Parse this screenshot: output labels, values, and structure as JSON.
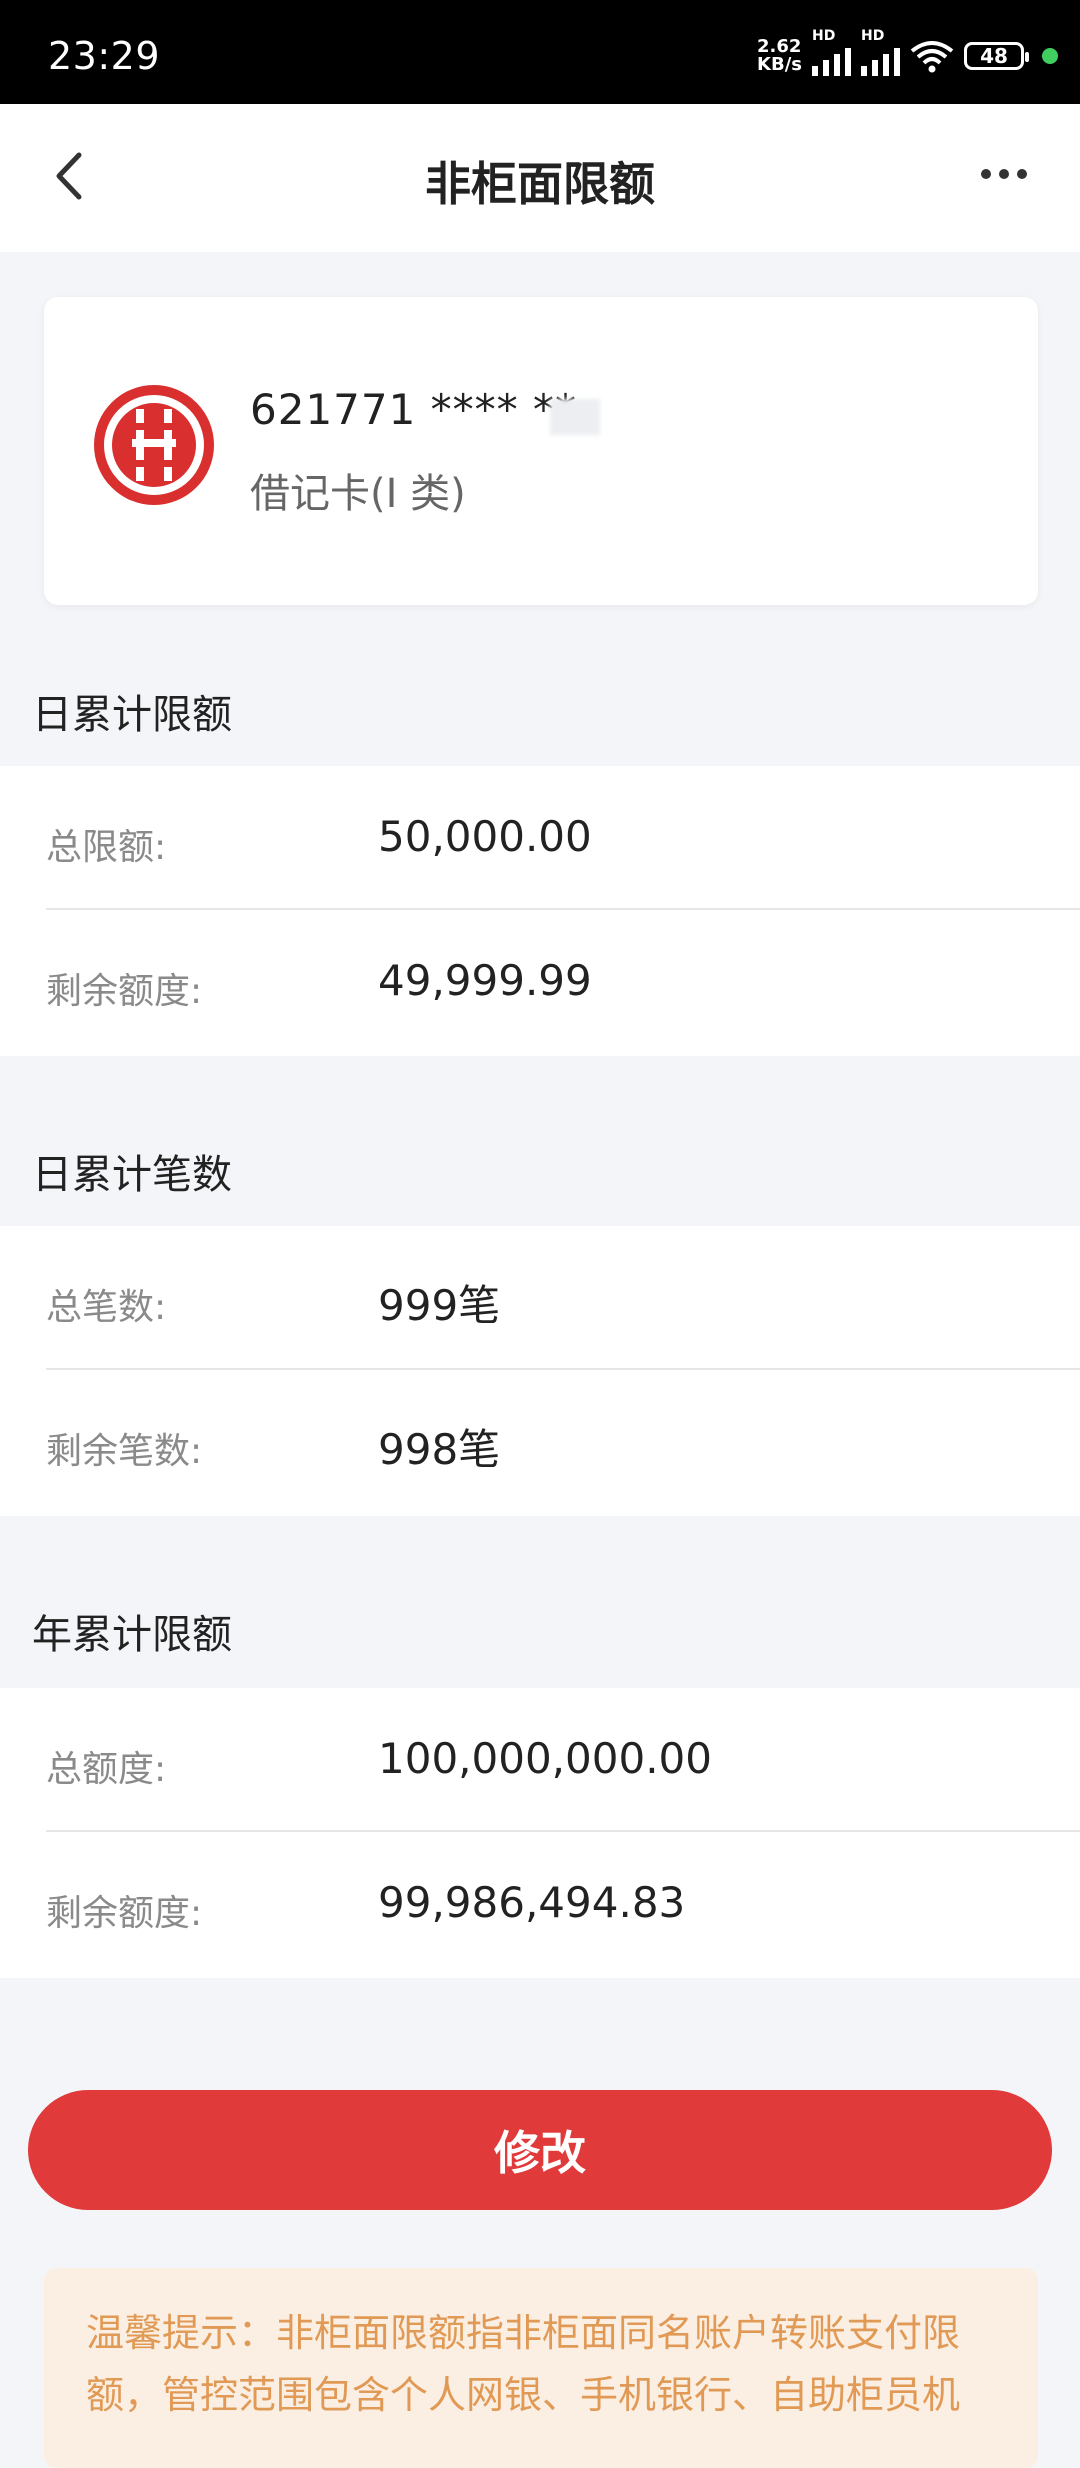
{
  "status_bar": {
    "time": "23:29",
    "net_speed_value": "2.62",
    "net_speed_unit": "KB/s",
    "hd1": "HD",
    "hd2": "HD",
    "battery": "48"
  },
  "nav": {
    "title": "非柜面限额"
  },
  "card": {
    "number": "621771 **** **",
    "type": "借记卡(I 类)"
  },
  "sections": [
    {
      "title": "日累计限额",
      "rows": [
        {
          "label": "总限额:",
          "value": "50,000.00"
        },
        {
          "label": "剩余额度:",
          "value": "49,999.99"
        }
      ]
    },
    {
      "title": "日累计笔数",
      "rows": [
        {
          "label": "总笔数:",
          "value": "999笔"
        },
        {
          "label": "剩余笔数:",
          "value": "998笔"
        }
      ]
    },
    {
      "title": "年累计限额",
      "rows": [
        {
          "label": "总额度:",
          "value": "100,000,000.00"
        },
        {
          "label": "剩余额度:",
          "value": "99,986,494.83"
        }
      ]
    }
  ],
  "actions": {
    "modify_label": "修改"
  },
  "tip": {
    "text": "温馨提示：非柜面限额指非柜面同名账户转账支付限额，管控范围包含个人网银、手机银行、自助柜员机"
  },
  "colors": {
    "accent": "#e03a3a",
    "tip_text": "#e19a55",
    "tip_bg": "#fbefe4"
  }
}
